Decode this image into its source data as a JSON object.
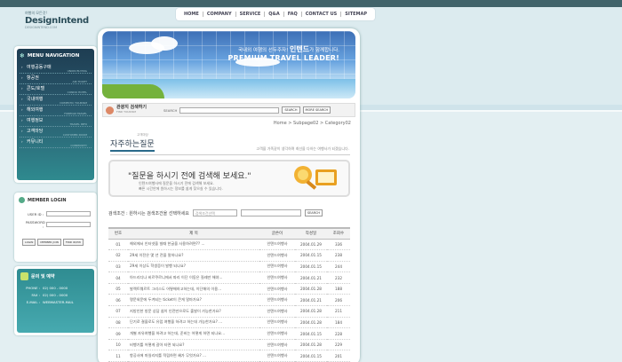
{
  "logo": {
    "small": "여행의 모든것!",
    "name": "DesignIntend",
    "url": "DESIGNINTEND.COM"
  },
  "topnav": [
    "HOME",
    "COMPANY",
    "SERVICE",
    "Q&A",
    "FAQ",
    "CONTACT US",
    "SITEMAP"
  ],
  "menu": {
    "title": "MENU NAVIGATION",
    "items": [
      {
        "ko": "여행공동구매",
        "en": "UNION BUYING"
      },
      {
        "ko": "항공권",
        "en": "AIR TICKET"
      },
      {
        "ko": "콘도/호텔",
        "en": "CONDO HOTEL"
      },
      {
        "ko": "국내여행",
        "en": "DOMESTIC TOURISM"
      },
      {
        "ko": "해외여행",
        "en": "FOREIGN TRAVEL"
      },
      {
        "ko": "여행정보",
        "en": "TRAVEL INFO"
      },
      {
        "ko": "고객마당",
        "en": "CUSTOMER ROOM"
      },
      {
        "ko": "커뮤니티",
        "en": "COMMUNITY"
      }
    ]
  },
  "login": {
    "title": "MEMBER LOGIN",
    "id_label": "USER ID :",
    "pw_label": "PASSWORD :",
    "buttons": [
      "LOGIN",
      "MEMBER JOIN",
      "FIND ID/PW"
    ]
  },
  "contact": {
    "title": "문의 및 예약",
    "rows": [
      {
        "k": "PHONE :",
        "v": "02) 000 - 0000"
      },
      {
        "k": "FAX :",
        "v": "02) 000 - 0000"
      },
      {
        "k": "E-MAIL :",
        "v": "WEBMASTER-MAIL"
      }
    ]
  },
  "hero": {
    "ko_prefix": "국내외 여행의 선두주자!",
    "ko_brand": "인텐드",
    "ko_suffix": "가 함께합니다.",
    "en": "PREMIUM TRAVEL LEADER!"
  },
  "quicksearch": {
    "title": "관광지 검색하기",
    "subtitle": "FIND TOURISM",
    "label": "SEARCH",
    "btn1": "SEARCH",
    "btn2": "MORE SEARCH"
  },
  "breadcrumb": "Home > Subpage02 > Category02",
  "page": {
    "small": "고객마당",
    "title": "자주하는질문",
    "desc": "고객을 가족같이 생각하며 최선을 다하는 여행사가 되겠습니다."
  },
  "faqbox": {
    "question": "\"질문을 하시기 전에 검색해 보세요.\"",
    "desc1": "인텐드여행사에 질문을 하시기 전에 검색해 보세요.",
    "desc2": "빠른 시간안에 원하시는 정보를 쉽게 찾으실 수 있습니다."
  },
  "searchcond": {
    "label": "검색조건 : 원하시는 검색조건을 선택하세요",
    "select": "검색조건선택",
    "btn": "SEARCH"
  },
  "table": {
    "headers": [
      "번호",
      "제 목",
      "글쓴이",
      "작성일",
      "조회수"
    ],
    "rows": [
      [
        "01",
        "해외에서 인터넷을 빌때 한글을 사용하려면?? ...",
        "인텐드여행사",
        "2004.01.29",
        "336"
      ],
      [
        "02",
        "29세 이전은 몇 년 전을 말하나요?",
        "인텐드여행사",
        "2004.01.15",
        "238"
      ],
      [
        "03",
        "29세 이상도 학생증이 발행 되나요?",
        "인텐드여행사",
        "2004.01.15",
        "244"
      ],
      [
        "04",
        "아드리디나 비르쿠르니에서 파리 이단 이동은 질레만 해야...",
        "인텐드여행사",
        "2004.01.21",
        "232"
      ],
      [
        "05",
        "발렉트웨르트 그리스도 어떻해하고하는데, 이단해의 이용...",
        "인텐드여행사",
        "2004.01.28",
        "188"
      ],
      [
        "06",
        "명문외문에 두겨되는 ticket이 큰게 얼마가요?",
        "인텐드여행사",
        "2004.01.21",
        "206"
      ],
      [
        "07",
        "지방인한 방문 상담 쉽이 인전만으로도 출발이 가능한가요?",
        "인텐드여행사",
        "2004.01.28",
        "211"
      ],
      [
        "08",
        "단기로 결을로도 유럽 여행을 하려고 하는데 가능한가요? ...",
        "인텐드여행사",
        "2004.01.28",
        "184"
      ],
      [
        "09",
        "개별 자유여행을 하려고 하는데, 준비는 어떻게 하면 되나요...",
        "인텐드여행사",
        "2004.01.15",
        "228"
      ],
      [
        "10",
        "비행기를 어떻게 갈아 타면 되나요?",
        "인텐드여행사",
        "2004.01.28",
        "229"
      ],
      [
        "11",
        "항공사에 마일리지를 적립하면 혜가 무엇가요? ...",
        "인텐드여행사",
        "2004.01.15",
        "201"
      ]
    ]
  }
}
